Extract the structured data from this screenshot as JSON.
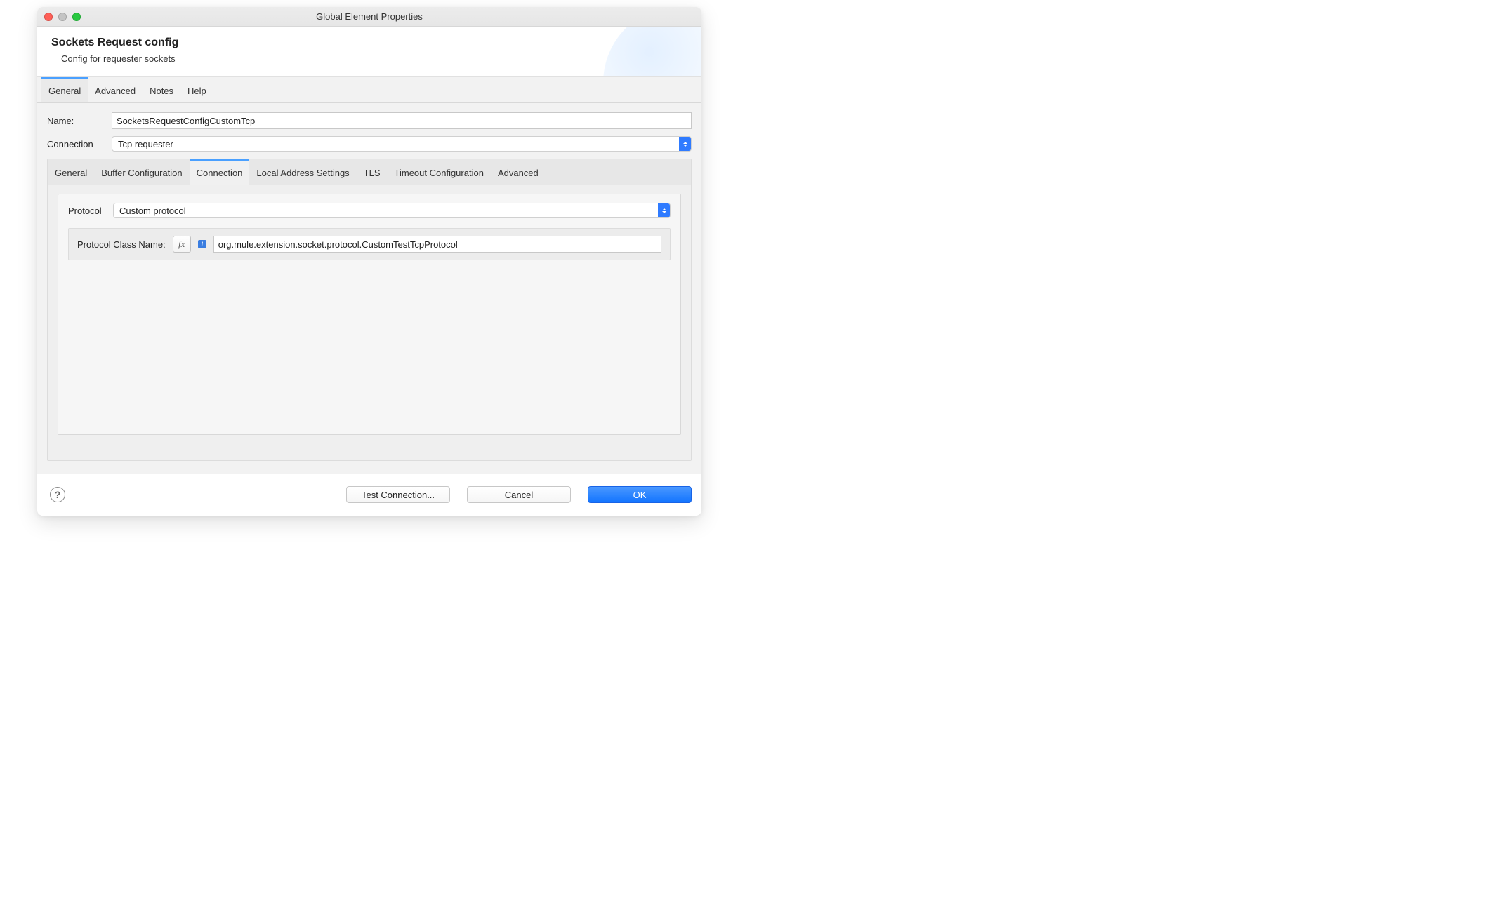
{
  "window": {
    "title": "Global Element Properties"
  },
  "header": {
    "title": "Sockets Request config",
    "subtitle": "Config for requester sockets"
  },
  "top_tabs": [
    "General",
    "Advanced",
    "Notes",
    "Help"
  ],
  "top_tabs_active_index": 0,
  "fields": {
    "name_label": "Name:",
    "name_value": "SocketsRequestConfigCustomTcp",
    "connection_label": "Connection",
    "connection_value": "Tcp requester"
  },
  "inner_tabs": [
    "General",
    "Buffer Configuration",
    "Connection",
    "Local Address Settings",
    "TLS",
    "Timeout Configuration",
    "Advanced"
  ],
  "inner_tabs_active_index": 2,
  "connection_panel": {
    "protocol_label": "Protocol",
    "protocol_value": "Custom protocol",
    "class_label": "Protocol Class Name:",
    "fx_label": "fx",
    "info_glyph": "i",
    "class_value": "org.mule.extension.socket.protocol.CustomTestTcpProtocol"
  },
  "footer": {
    "help_glyph": "?",
    "test": "Test Connection...",
    "cancel": "Cancel",
    "ok": "OK"
  }
}
